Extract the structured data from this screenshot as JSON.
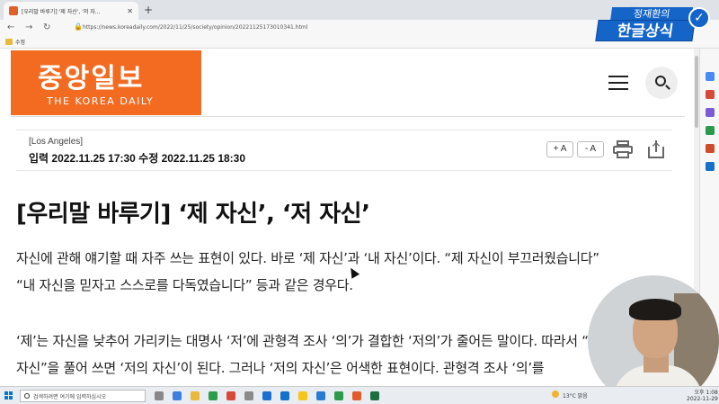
{
  "browser": {
    "tab_title": "[우리말 바루기] '제 자신', '저 자...",
    "tab_close": "✕",
    "new_tab": "+",
    "url": "https://news.koreadaily.com/2022/11/25/society/opinion/20221125173010341.html",
    "bookmark_label": "수정",
    "back": "←",
    "forward": "→",
    "reload": "↻",
    "lock": "🔒",
    "minimize": "—"
  },
  "overlay": {
    "top_text": "정재환의",
    "bottom_text": "한글상식",
    "check": "✓"
  },
  "site": {
    "logo_kr": "중앙일보",
    "logo_en": "THE KOREA DAILY"
  },
  "meta": {
    "location": "[Los Angeles]",
    "date": "입력 2022.11.25 17:30 수정 2022.11.25 18:30",
    "font_up": "+ A",
    "font_down": "- A"
  },
  "article": {
    "title": "[우리말 바루기] ‘제 자신’, ‘저 자신’",
    "p1_line1": "자신에 관해 얘기할 때 자주 쓰는 표현이 있다. 바로 ‘제 자신’과 ‘내 자신’이다. “제 자신이 부끄러웠습니다”",
    "p1_line2": "“내 자신을 믿자고 스스로를 다독였습니다” 등과 같은 경우다.",
    "p2_line1": "‘제’는 자신을 낮추어 가리키는 대명사 ‘저’에 관형격 조사 ‘의’가 결합한 ‘저의’가 줄어든 말이다. 따라서 “제",
    "p2_line2": "자신”을 풀어 쓰면 ‘저의 자신’이 된다. 그러나 ‘저의 자신’은 어색한 표현이다. 관형격 조사 ‘의’를"
  },
  "taskbar": {
    "search_placeholder": "검색하려면 여기에 입력하십시오",
    "weather": "13°C 맑음",
    "time": "오후 1:08",
    "date": "2022-11-29"
  },
  "colors": {
    "brand": "#f26b21",
    "overlay_blue": "#1565c8"
  }
}
